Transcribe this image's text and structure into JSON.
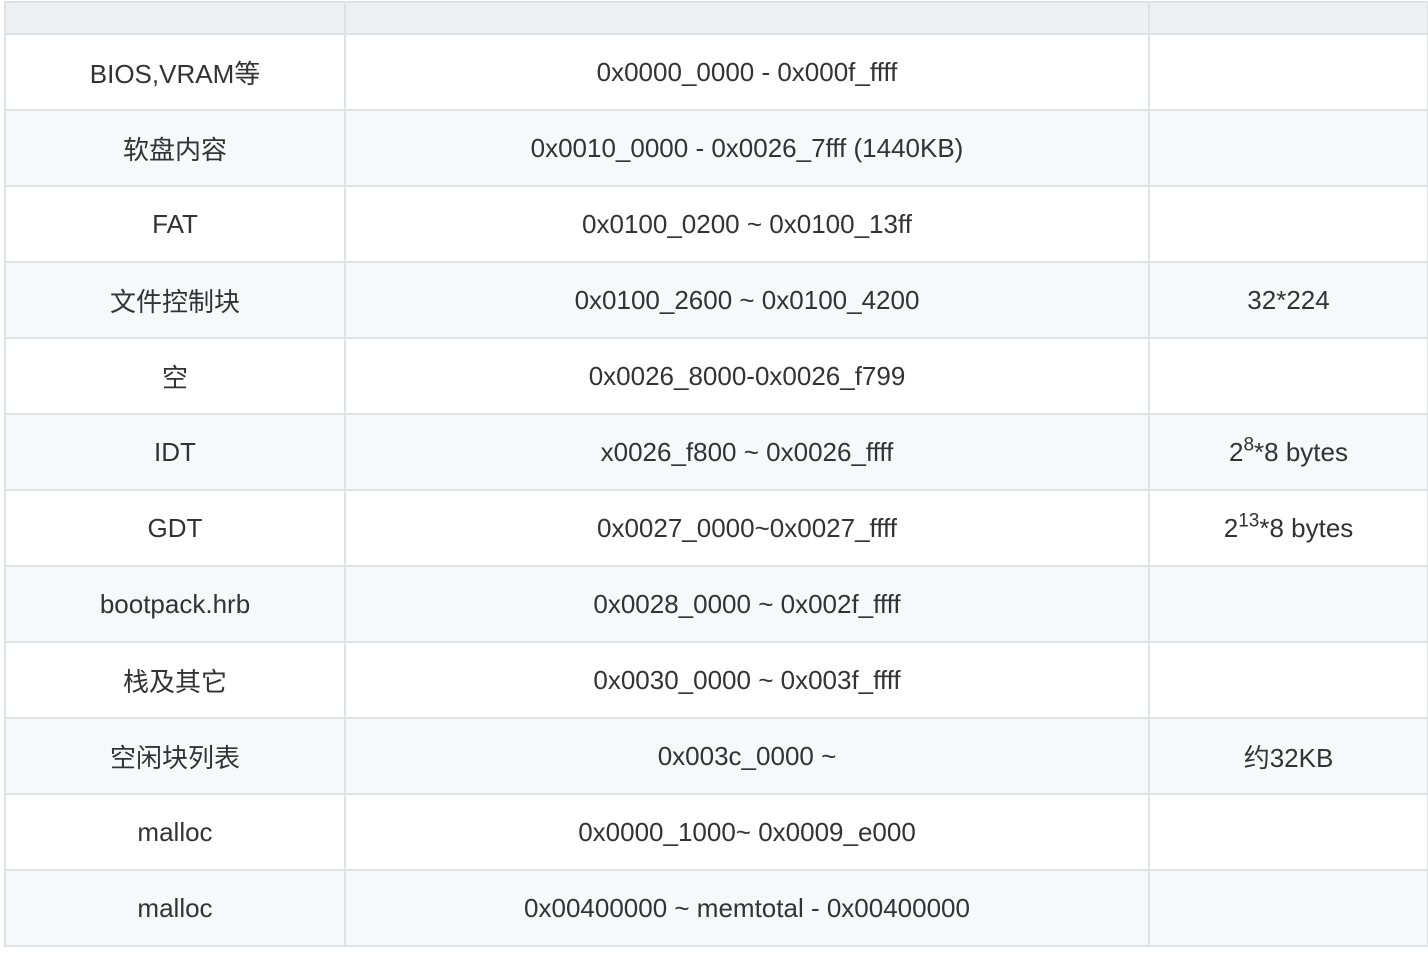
{
  "table": {
    "headers": [
      "",
      "",
      ""
    ],
    "rows": [
      {
        "name": "BIOS,VRAM等",
        "range": "0x0000_0000 - 0x000f_ffff",
        "note": ""
      },
      {
        "name": "软盘内容",
        "range": "0x0010_0000 - 0x0026_7fff (1440KB)",
        "note": ""
      },
      {
        "name": "FAT",
        "range": "0x0100_0200 ~ 0x0100_13ff",
        "note": ""
      },
      {
        "name": "文件控制块",
        "range": "0x0100_2600 ~ 0x0100_4200",
        "note": "32*224"
      },
      {
        "name": "空",
        "range": "0x0026_8000-0x0026_f799",
        "note": ""
      },
      {
        "name": "IDT",
        "range": "x0026_f800 ~ 0x0026_ffff",
        "note_base": "2",
        "note_exp": "8",
        "note_rest": "*8 bytes"
      },
      {
        "name": "GDT",
        "range": "0x0027_0000~0x0027_ffff",
        "note_base": "2",
        "note_exp": "13",
        "note_rest": "*8 bytes"
      },
      {
        "name": "bootpack.hrb",
        "range": "0x0028_0000 ~ 0x002f_ffff",
        "note": ""
      },
      {
        "name": "栈及其它",
        "range": "0x0030_0000 ~ 0x003f_ffff",
        "note": ""
      },
      {
        "name": "空闲块列表",
        "range": "0x003c_0000 ~",
        "note": "约32KB"
      },
      {
        "name": "malloc",
        "range": "0x0000_1000~ 0x0009_e000",
        "note": ""
      },
      {
        "name": "malloc",
        "range": "0x00400000 ~ memtotal - 0x00400000",
        "note": ""
      }
    ]
  }
}
